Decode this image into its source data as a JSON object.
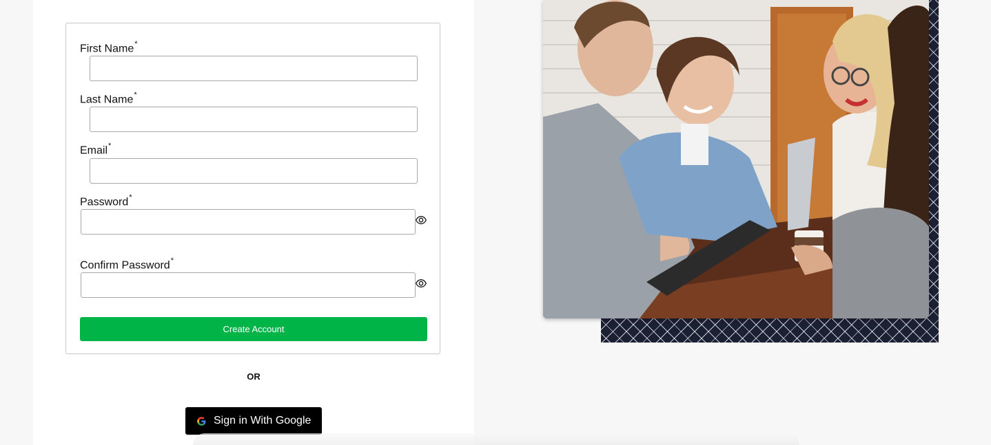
{
  "form": {
    "fields": [
      {
        "label": "First Name",
        "required_mark": "*",
        "value": "",
        "type": "text"
      },
      {
        "label": "Last Name",
        "required_mark": "*",
        "value": "",
        "type": "text"
      },
      {
        "label": "Email",
        "required_mark": "*",
        "value": "",
        "type": "email"
      },
      {
        "label": "Password",
        "required_mark": "*",
        "value": "",
        "type": "password",
        "icon": "eye-icon"
      },
      {
        "label": "Confirm Password",
        "required_mark": "*",
        "value": "",
        "type": "password",
        "icon": "eye-icon"
      }
    ],
    "submit_label": "Create Account"
  },
  "divider_text": "OR",
  "google": {
    "label": "Sign in With Google",
    "icon": "google-logo-icon"
  },
  "colors": {
    "submit_bg": "#00b448",
    "google_bg": "#000000",
    "pattern_bg": "#1c2033"
  },
  "photo": {
    "alt": "Group of friends smiling around a cafe table with laptop and tablet"
  }
}
